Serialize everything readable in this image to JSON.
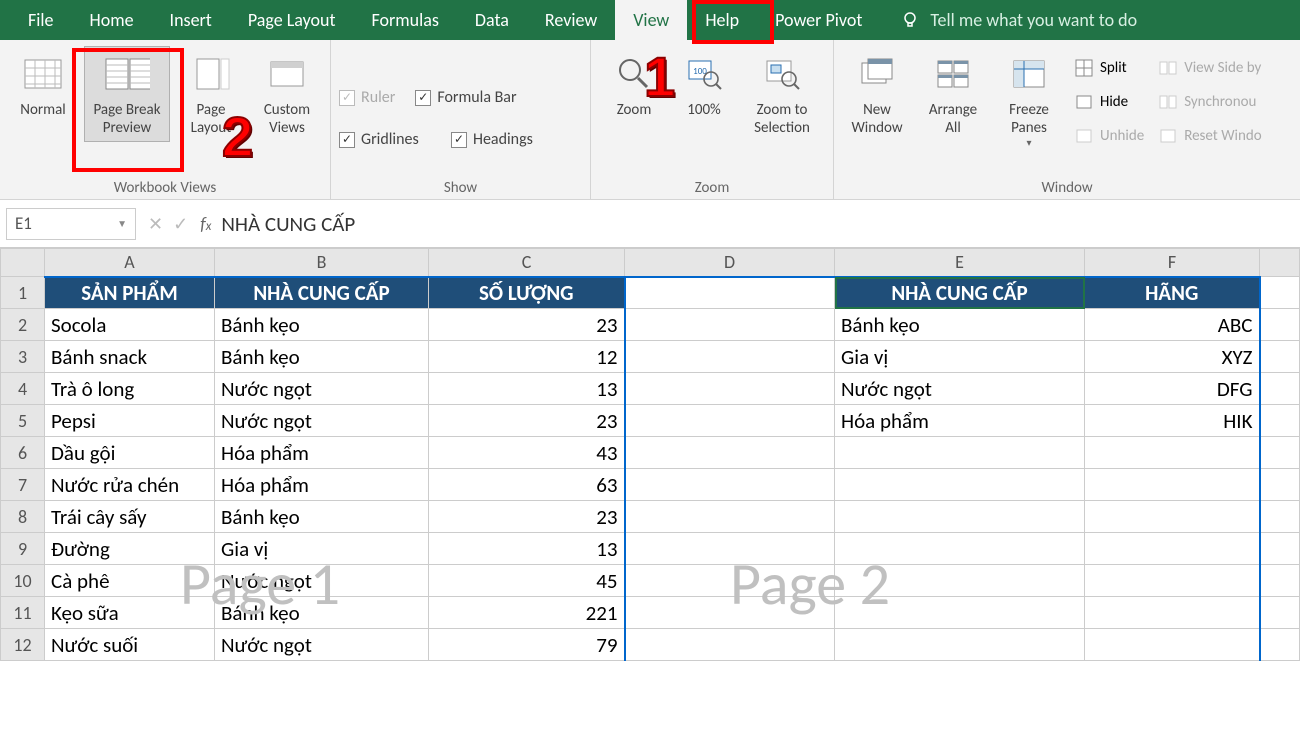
{
  "menu": {
    "tabs": [
      "File",
      "Home",
      "Insert",
      "Page Layout",
      "Formulas",
      "Data",
      "Review",
      "View",
      "Help",
      "Power Pivot"
    ],
    "active": "View",
    "tellme": "Tell me what you want to do"
  },
  "ribbon": {
    "workbookViews": {
      "normal": "Normal",
      "pageBreak": "Page Break Preview",
      "pageLayout": "Page Layout",
      "customViews": "Custom Views",
      "groupLabel": "Workbook Views"
    },
    "show": {
      "ruler": "Ruler",
      "formulaBar": "Formula Bar",
      "gridlines": "Gridlines",
      "headings": "Headings",
      "groupLabel": "Show"
    },
    "zoom": {
      "zoom": "Zoom",
      "hundred": "100%",
      "toSelection": "Zoom to Selection",
      "groupLabel": "Zoom"
    },
    "window": {
      "newWindow": "New Window",
      "arrangeAll": "Arrange All",
      "freezePanes": "Freeze Panes",
      "split": "Split",
      "hide": "Hide",
      "unhide": "Unhide",
      "viewSide": "View Side by",
      "sync": "Synchronou",
      "reset": "Reset Windo",
      "groupLabel": "Window"
    }
  },
  "namebox": {
    "ref": "E1"
  },
  "formula": {
    "value": "NHÀ CUNG CẤP"
  },
  "columns": [
    "A",
    "B",
    "C",
    "D",
    "E",
    "F"
  ],
  "headers1": {
    "A": "SẢN PHẨM",
    "B": "NHÀ CUNG CẤP",
    "C": "SỐ LƯỢNG"
  },
  "headers2": {
    "E": "NHÀ CUNG CẤP",
    "F": "HÃNG"
  },
  "table1": [
    {
      "a": "Socola",
      "b": "Bánh kẹo",
      "c": "23"
    },
    {
      "a": "Bánh snack",
      "b": "Bánh kẹo",
      "c": "12"
    },
    {
      "a": "Trà ô long",
      "b": "Nước ngọt",
      "c": "13"
    },
    {
      "a": "Pepsi",
      "b": "Nước ngọt",
      "c": "23"
    },
    {
      "a": "Dầu gội",
      "b": "Hóa phẩm",
      "c": "43"
    },
    {
      "a": "Nước rửa chén",
      "b": "Hóa phẩm",
      "c": "63"
    },
    {
      "a": "Trái cây sấy",
      "b": "Bánh kẹo",
      "c": "23"
    },
    {
      "a": "Đường",
      "b": "Gia vị",
      "c": "13"
    },
    {
      "a": "Cà phê",
      "b": "Nước ngọt",
      "c": "45"
    },
    {
      "a": "Kẹo sữa",
      "b": "Bánh kẹo",
      "c": "221"
    },
    {
      "a": "Nước suối",
      "b": "Nước ngọt",
      "c": "79"
    }
  ],
  "table2": [
    {
      "e": "Bánh kẹo",
      "f": "ABC"
    },
    {
      "e": "Gia vị",
      "f": "XYZ"
    },
    {
      "e": "Nước ngọt",
      "f": "DFG"
    },
    {
      "e": "Hóa phẩm",
      "f": "HIK"
    }
  ],
  "watermarks": {
    "p1": "Page 1",
    "p2": "Page 2"
  },
  "callouts": {
    "one": "1",
    "two": "2"
  }
}
